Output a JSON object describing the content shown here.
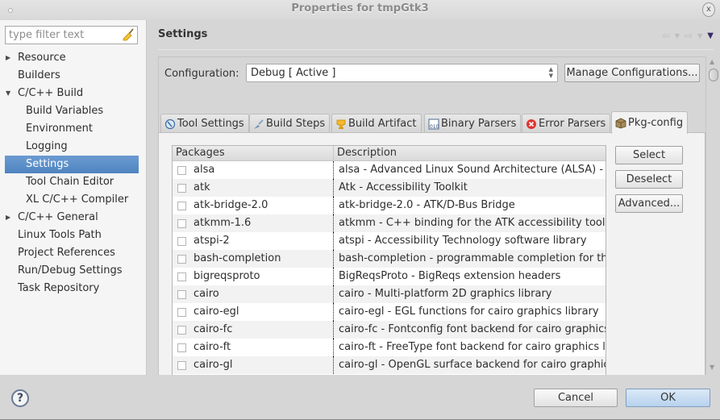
{
  "window": {
    "title": "Properties for tmpGtk3",
    "close_label": "x"
  },
  "sidebar": {
    "filter_placeholder": "type filter text",
    "filter_value": "",
    "items": [
      {
        "label": "Resource",
        "level": 0,
        "expander": "collapsed"
      },
      {
        "label": "Builders",
        "level": 0,
        "expander": "none"
      },
      {
        "label": "C/C++ Build",
        "level": 0,
        "expander": "expanded"
      },
      {
        "label": "Build Variables",
        "level": 1,
        "expander": "none"
      },
      {
        "label": "Environment",
        "level": 1,
        "expander": "none"
      },
      {
        "label": "Logging",
        "level": 1,
        "expander": "none"
      },
      {
        "label": "Settings",
        "level": 1,
        "expander": "none",
        "selected": true
      },
      {
        "label": "Tool Chain Editor",
        "level": 1,
        "expander": "none"
      },
      {
        "label": "XL C/C++ Compiler",
        "level": 1,
        "expander": "none"
      },
      {
        "label": "C/C++ General",
        "level": 0,
        "expander": "collapsed"
      },
      {
        "label": "Linux Tools Path",
        "level": 0,
        "expander": "none"
      },
      {
        "label": "Project References",
        "level": 0,
        "expander": "none"
      },
      {
        "label": "Run/Debug Settings",
        "level": 0,
        "expander": "none"
      },
      {
        "label": "Task Repository",
        "level": 0,
        "expander": "none"
      }
    ]
  },
  "header": {
    "title": "Settings",
    "nav": {
      "back_icon": "back-arrow-icon",
      "forward_icon": "forward-arrow-icon",
      "menu_icon": "view-menu-icon"
    }
  },
  "configuration": {
    "label": "Configuration:",
    "selected": "Debug  [ Active ]",
    "manage_label": "Manage Configurations..."
  },
  "tabs": [
    {
      "label": "Tool Settings",
      "icon": "tool-settings-icon",
      "active": false
    },
    {
      "label": "Build Steps",
      "icon": "build-steps-icon",
      "active": false
    },
    {
      "label": "Build Artifact",
      "icon": "build-artifact-icon",
      "active": false
    },
    {
      "label": "Binary Parsers",
      "icon": "binary-parsers-icon",
      "active": false
    },
    {
      "label": "Error Parsers",
      "icon": "error-parsers-icon",
      "active": false
    },
    {
      "label": "Pkg-config",
      "icon": "pkg-config-icon",
      "active": true
    }
  ],
  "packages_table": {
    "columns": [
      "Packages",
      "Description"
    ],
    "rows": [
      {
        "name": "alsa",
        "description": "alsa - Advanced Linux Sound Architecture (ALSA) -",
        "checked": false
      },
      {
        "name": "atk",
        "description": "Atk - Accessibility Toolkit",
        "checked": false
      },
      {
        "name": "atk-bridge-2.0",
        "description": "atk-bridge-2.0 - ATK/D-Bus Bridge",
        "checked": false
      },
      {
        "name": "atkmm-1.6",
        "description": "atkmm - C++ binding for the ATK accessibility tool",
        "checked": false
      },
      {
        "name": "atspi-2",
        "description": "atspi - Accessibility Technology software library",
        "checked": false
      },
      {
        "name": "bash-completion",
        "description": "bash-completion - programmable completion for th",
        "checked": false
      },
      {
        "name": "bigreqsproto",
        "description": "BigReqsProto - BigReqs extension headers",
        "checked": false
      },
      {
        "name": "cairo",
        "description": "cairo - Multi-platform 2D graphics library",
        "checked": false
      },
      {
        "name": "cairo-egl",
        "description": "cairo-egl - EGL functions for cairo graphics library",
        "checked": false
      },
      {
        "name": "cairo-fc",
        "description": "cairo-fc - Fontconfig font backend for cairo graphics",
        "checked": false
      },
      {
        "name": "cairo-ft",
        "description": "cairo-ft - FreeType font backend for cairo graphics l",
        "checked": false
      },
      {
        "name": "cairo-gl",
        "description": "cairo-gl - OpenGL surface backend for cairo graphic",
        "checked": false
      }
    ]
  },
  "side_buttons": {
    "select": "Select",
    "deselect": "Deselect",
    "advanced": "Advanced..."
  },
  "footer": {
    "help_label": "?",
    "cancel": "Cancel",
    "ok": "OK"
  },
  "colors": {
    "selection": "#5b8fc9",
    "ok_button": "#c5dcf2"
  }
}
